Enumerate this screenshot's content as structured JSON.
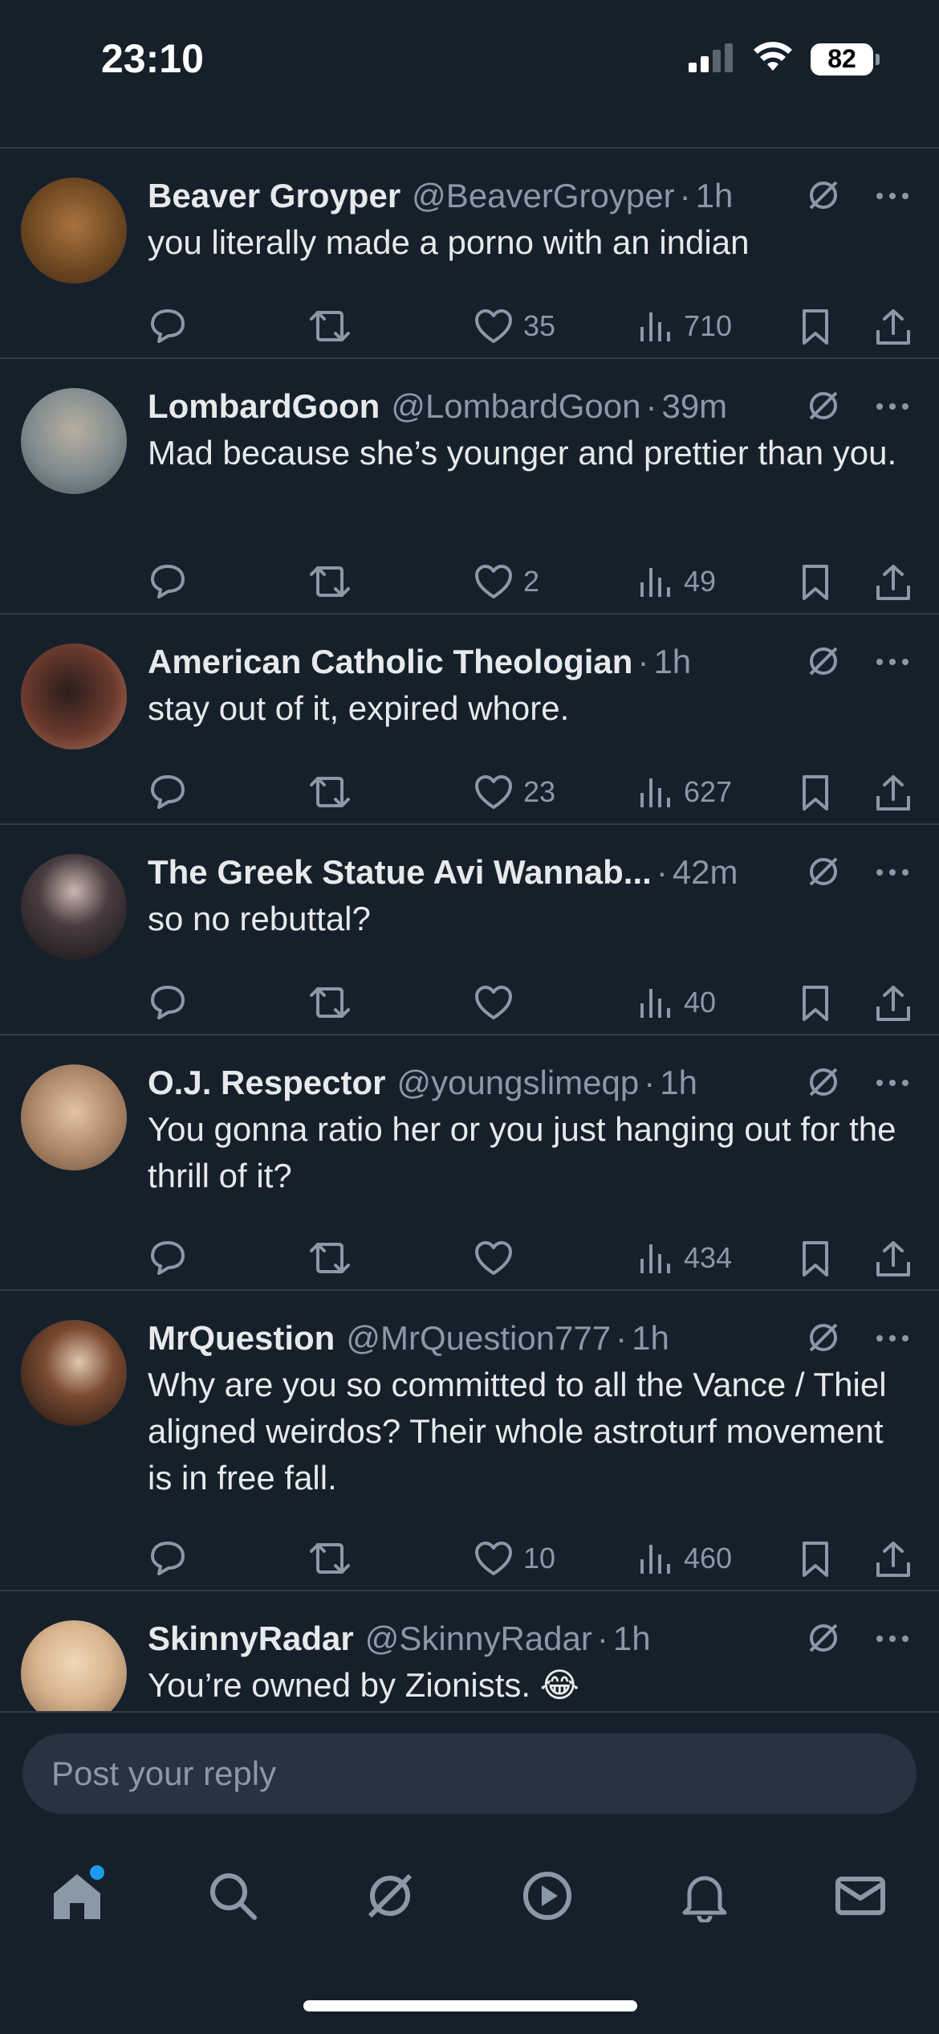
{
  "status_bar": {
    "time": "23:10",
    "battery": "82"
  },
  "tweets": [
    {
      "name": "Beaver Groyper",
      "handle": "@BeaverGroyper",
      "time": "1h",
      "text": "you literally made a porno with an indian",
      "likes": "35",
      "views": "710",
      "avatar_color": "#8a5a2b"
    },
    {
      "name": "LombardGoon",
      "handle": "@LombardGoon",
      "time": "39m",
      "text": "Mad because she’s younger and prettier than you.",
      "likes": "2",
      "views": "49",
      "avatar_color": "#9fa5a8"
    },
    {
      "name": "American Catholic Theologian",
      "handle": "",
      "time": "1h",
      "text": "stay out of it, expired whore.",
      "likes": "23",
      "views": "627",
      "avatar_color": "#6b3a2e"
    },
    {
      "name": "The Greek Statue Avi Wannab...",
      "handle": "",
      "time": "42m",
      "text": "so no rebuttal?",
      "likes": "",
      "views": "40",
      "avatar_color": "#2a2a2e"
    },
    {
      "name": "O.J. Respector",
      "handle": "@youngslimeqp",
      "time": "1h",
      "text": "You gonna ratio her or you just hanging out for the thrill of it?",
      "likes": "",
      "views": "434",
      "avatar_color": "#c9a88a"
    },
    {
      "name": "MrQuestion",
      "handle": "@MrQuestion777",
      "time": "1h",
      "text": "Why are you so committed to all the Vance / Thiel aligned weirdos? Their whole astroturf movement is in free fall.",
      "likes": "10",
      "views": "460",
      "avatar_color": "#3a2a22"
    },
    {
      "name": "SkinnyRadar",
      "handle": "@SkinnyRadar",
      "time": "1h",
      "text": "You’re owned by Zionists. 😂",
      "likes": "",
      "views": "",
      "avatar_color": "#d9b48f"
    }
  ],
  "reply": {
    "placeholder": "Post your reply"
  },
  "tab_bar": {
    "items": [
      {
        "name": "home-icon"
      },
      {
        "name": "search-icon"
      },
      {
        "name": "grok-icon"
      },
      {
        "name": "video-icon"
      },
      {
        "name": "notifications-icon"
      },
      {
        "name": "messages-icon"
      }
    ]
  },
  "colors": {
    "background": "#15202b",
    "muted": "#8b98a5",
    "accent": "#1d9bf0"
  }
}
